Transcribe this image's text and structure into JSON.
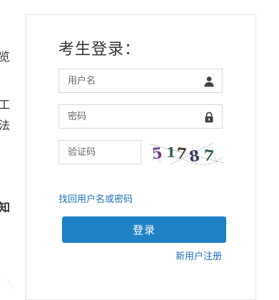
{
  "background_fragments": [
    "览",
    "工",
    "法",
    "知"
  ],
  "login": {
    "title": "考生登录：",
    "username_placeholder": "用户名",
    "password_placeholder": "密码",
    "captcha_placeholder": "验证码",
    "captcha_text": "51787",
    "forgot_link": "找回用户名或密码",
    "login_button": "登录",
    "register_link": "新用户注册"
  },
  "colors": {
    "accent": "#1f82c7",
    "link": "#1f6fbf",
    "border": "#d9d9d9"
  },
  "icons": {
    "username": "user-icon",
    "password": "lock-icon"
  }
}
